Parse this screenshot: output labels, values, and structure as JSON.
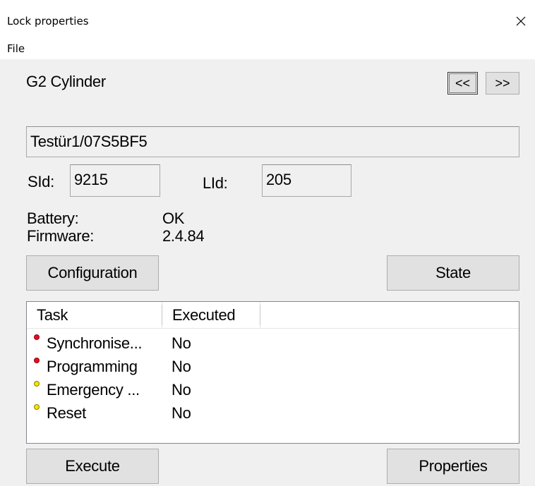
{
  "window": {
    "title": "Lock properties"
  },
  "menu": {
    "file": "File"
  },
  "lock": {
    "type": "G2 Cylinder",
    "name": "Testür1/07S5BF5",
    "sid_label": "SId:",
    "sid_value": "9215",
    "lid_label": "LId:",
    "lid_value": "205",
    "battery_label": "Battery:",
    "battery_value": "OK",
    "firmware_label": "Firmware:",
    "firmware_value": "2.4.84"
  },
  "nav": {
    "prev": "<<",
    "next": ">>"
  },
  "buttons": {
    "configuration": "Configuration",
    "state": "State",
    "execute": "Execute",
    "properties": "Properties"
  },
  "tasks": {
    "columns": [
      "Task",
      "Executed"
    ],
    "rows": [
      {
        "task": "Synchronise...",
        "executed": "No",
        "status_color": "#e0102a"
      },
      {
        "task": "Programming",
        "executed": "No",
        "status_color": "#e0102a"
      },
      {
        "task": "Emergency ...",
        "executed": "No",
        "status_color": "#f5e400"
      },
      {
        "task": "Reset",
        "executed": "No",
        "status_color": "#f5e400"
      }
    ]
  }
}
